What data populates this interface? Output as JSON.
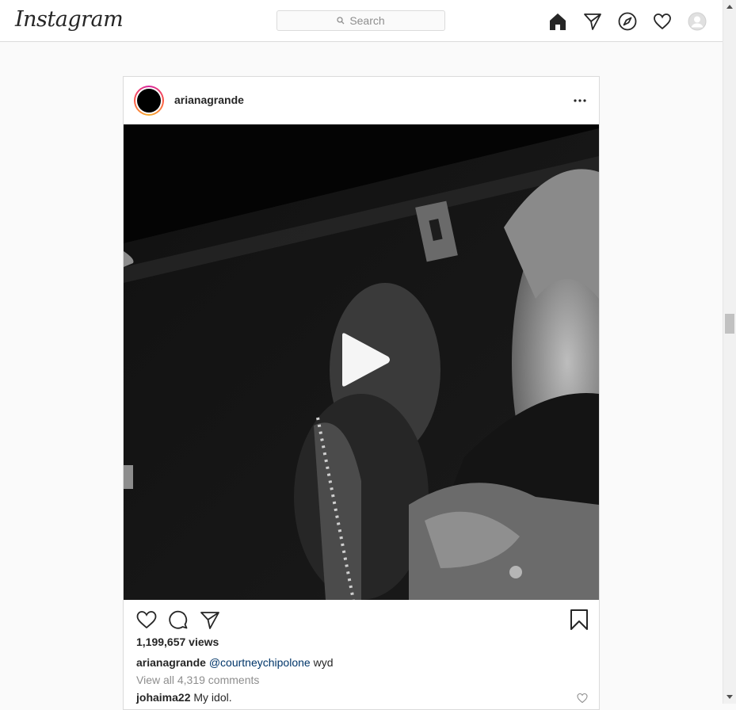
{
  "topbar": {
    "logo": "Instagram",
    "search_placeholder": "Search",
    "icons": [
      "home-icon",
      "direct-icon",
      "explore-icon",
      "activity-icon",
      "profile-icon"
    ]
  },
  "post": {
    "username": "arianagrande",
    "views": "1,199,657 views",
    "caption": {
      "username": "arianagrande",
      "mention": "@courtneychipolone",
      "text": "wyd"
    },
    "view_all_comments": "View all 4,319 comments",
    "comments": [
      {
        "username": "johaima22",
        "text": "My idol."
      }
    ]
  },
  "colors": {
    "border": "#dbdbdb",
    "mention": "#003569",
    "muted": "#8e8e8e"
  }
}
